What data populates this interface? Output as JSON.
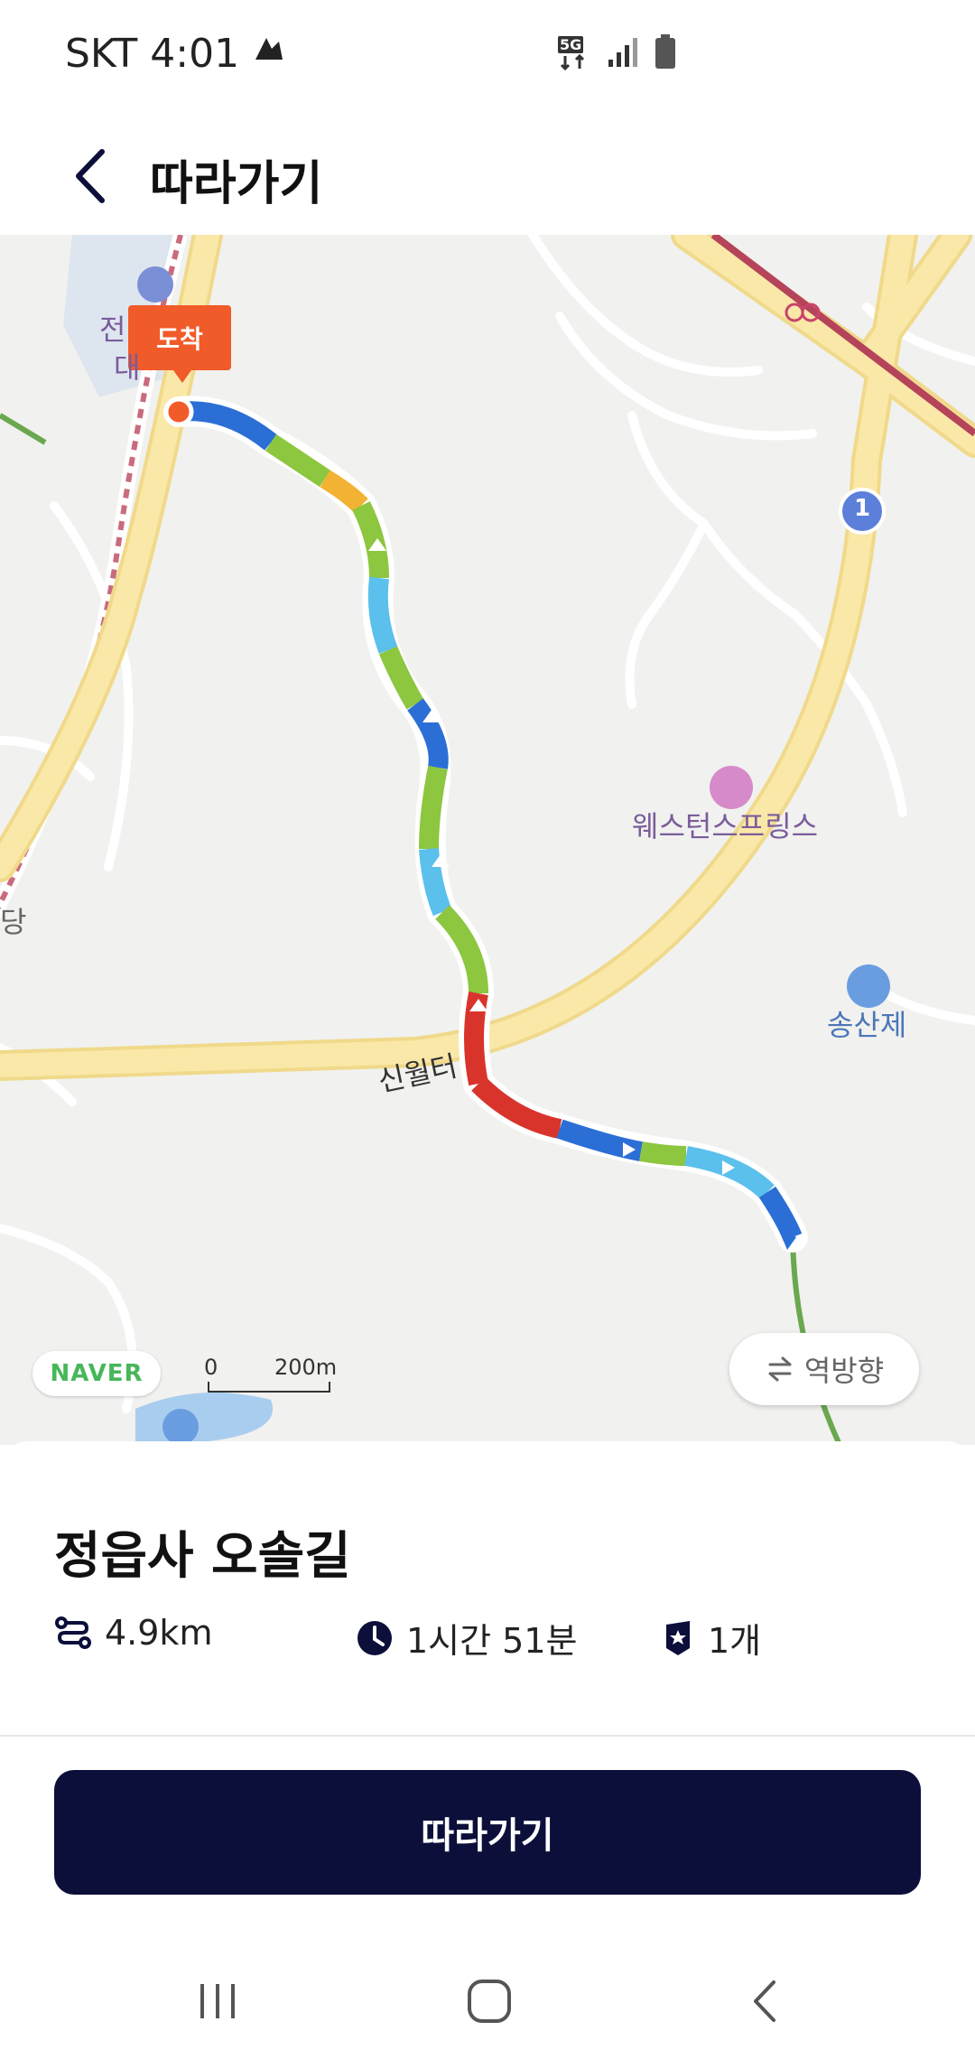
{
  "status_bar": {
    "carrier": "SKT",
    "time": "4:01",
    "network": "5G"
  },
  "header": {
    "title": "따라가기"
  },
  "map": {
    "arrival_label": "도착",
    "pois": {
      "western_springs": "웨스턴스프링스",
      "songsanje": "송산제",
      "left_partial_1": "전",
      "left_partial_2": "대",
      "left_partial_3": "당"
    },
    "road_label": "신월터",
    "route_marker": "1",
    "naver_logo": "NAVER",
    "scale_zero": "0",
    "scale_distance": "200m",
    "reverse_button": "역방향"
  },
  "trail": {
    "name": "정읍사 오솔길",
    "distance": "4.9km",
    "duration": "1시간 51분",
    "stamps": "1개"
  },
  "actions": {
    "follow_button": "따라가기"
  },
  "colors": {
    "primary_navy": "#0b0f3a",
    "arrival_orange": "#f15a29",
    "road_yellow": "#fae8a8",
    "naver_green": "#47b75a"
  }
}
